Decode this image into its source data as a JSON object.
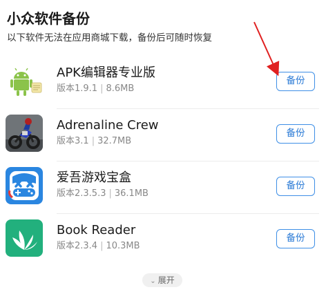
{
  "header": {
    "title": "小众软件备份",
    "subtitle": "以下软件无法在应用商城下载，备份后可随时恢复"
  },
  "apps": [
    {
      "name": "APK编辑器专业版",
      "version": "版本1.9.1",
      "size": "8.6MB",
      "button": "备份",
      "icon": "android-robot-icon"
    },
    {
      "name": "Adrenaline Crew",
      "version": "版本3.1",
      "size": "32.7MB",
      "button": "备份",
      "icon": "motorbike-game-icon"
    },
    {
      "name": "爱吾游戏宝盒",
      "version": "版本2.3.5.3",
      "size": "36.1MB",
      "button": "备份",
      "icon": "gamepad-box-icon"
    },
    {
      "name": "Book Reader",
      "version": "版本2.3.4",
      "size": "10.3MB",
      "button": "备份",
      "icon": "leaf-reader-icon"
    }
  ],
  "separator": "|",
  "expand": {
    "label": "展开",
    "icon": "chevron-down-icon"
  },
  "colors": {
    "accent": "#2a7ad6",
    "annotation": "#e02020"
  }
}
